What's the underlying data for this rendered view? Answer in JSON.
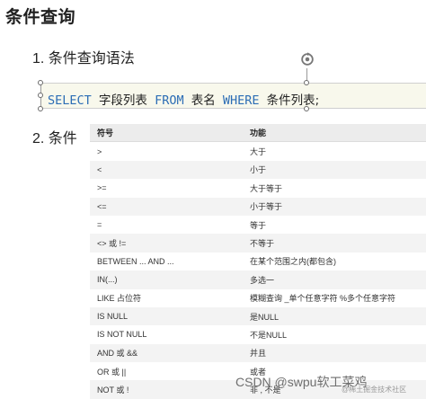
{
  "doc": {
    "title": "条件查询",
    "heading1": "1. 条件查询语法",
    "heading2": "2. 条件"
  },
  "code": {
    "kw_select": "SELECT",
    "fields": "字段列表",
    "kw_from": "FROM",
    "table": "表名",
    "kw_where": "WHERE",
    "conditions": "条件列表;"
  },
  "table": {
    "headers": [
      "符号",
      "功能"
    ],
    "rows": [
      [
        ">",
        "大于"
      ],
      [
        "<",
        "小于"
      ],
      [
        ">=",
        "大于等于"
      ],
      [
        "<=",
        "小于等于"
      ],
      [
        "=",
        "等于"
      ],
      [
        "<> 或 !=",
        "不等于"
      ],
      [
        "BETWEEN ... AND ...",
        "在某个范围之内(都包含)"
      ],
      [
        "IN(...)",
        "多选一"
      ],
      [
        "LIKE 占位符",
        "模糊查询 _单个任意字符 %多个任意字符"
      ],
      [
        "IS NULL",
        "是NULL"
      ],
      [
        "IS NOT NULL",
        "不是NULL"
      ],
      [
        "AND 或 &&",
        "并且"
      ],
      [
        "OR 或 ||",
        "或者"
      ],
      [
        "NOT 或 !",
        "非 , 不是"
      ]
    ]
  },
  "watermark": {
    "main": "CSDN @swpu软工菜鸡",
    "sub": "@稀土掘金技术社区"
  }
}
